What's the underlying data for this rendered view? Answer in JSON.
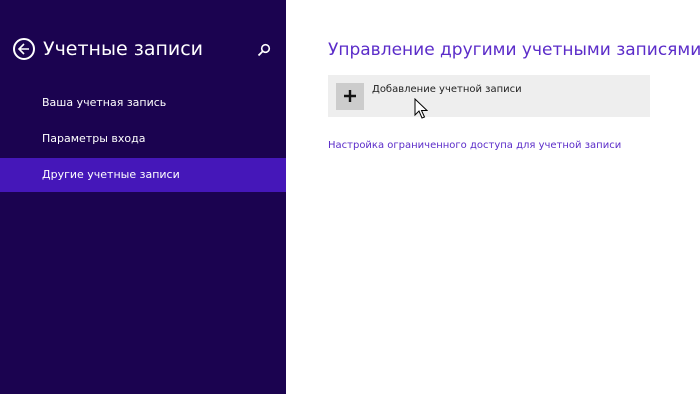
{
  "sidebar": {
    "title": "Учетные записи",
    "back_icon": "back-arrow-icon",
    "search_icon": "search-icon",
    "items": [
      {
        "label": "Ваша учетная запись",
        "selected": false
      },
      {
        "label": "Параметры входа",
        "selected": false
      },
      {
        "label": "Другие учетные записи",
        "selected": true
      }
    ]
  },
  "main": {
    "title": "Управление другими учетными записями",
    "add_account": {
      "icon": "plus-icon",
      "label": "Добавление учетной записи"
    },
    "assigned_access_link": "Настройка ограниченного доступа для учетной записи"
  },
  "colors": {
    "sidebar_bg": "#1b0350",
    "selected_item_bg": "#4517b9",
    "accent": "#5b2cc9",
    "tile_bg": "#eeeeee",
    "icon_box_bg": "#cccccc"
  }
}
